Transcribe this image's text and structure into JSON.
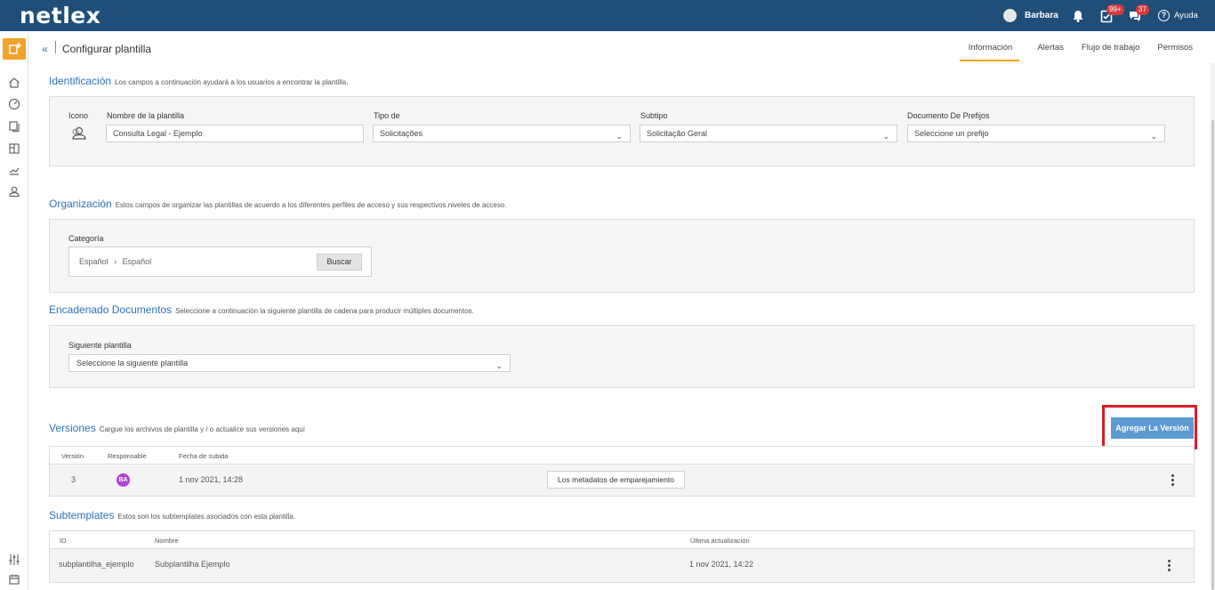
{
  "header": {
    "logo": "netlex",
    "user_name": "Barbara",
    "tasks_badge": "99+",
    "chat_badge": "37",
    "help_label": "Ayuda"
  },
  "page": {
    "title": "Configurar plantilla",
    "collapse": "«",
    "tabs": [
      {
        "label": "Información",
        "active": true
      },
      {
        "label": "Alertas"
      },
      {
        "label": "Flujo de trabajo"
      },
      {
        "label": "Permisos"
      }
    ]
  },
  "identificacion": {
    "title": "Identificación",
    "desc": "Los campos a continuación ayudará a los usuarios a encontrar la plantilla.",
    "icon_label": "Icono",
    "name_label": "Nombre de la plantilla",
    "name_value": "Consulta Legal - Ejemplo",
    "tipo_label": "Tipo de",
    "tipo_value": "Solicitações",
    "subtipo_label": "Subtipo",
    "subtipo_value": "Solicitação Geral",
    "prefix_label": "Documento De Prefijos",
    "prefix_placeholder": "Seleccione un prefijo"
  },
  "organizacion": {
    "title": "Organización",
    "desc": "Estos campos de organizar las plantillas de acuerdo a los diferentes perfiles de acceso y sus respectivos niveles de acceso.",
    "category_label": "Categoría",
    "crumb_1": "Español",
    "crumb_sep": "›",
    "crumb_2": "Español",
    "search_button": "Buscar"
  },
  "encadenado": {
    "title": "Encadenado Documentos",
    "desc": "Seleccione a continuación la siguiente plantilla de cadena para producir múltiples documentos.",
    "next_label": "Siguiente plantilla",
    "next_placeholder": "Seleccione la siguiente plantilla"
  },
  "versiones": {
    "title": "Versiones",
    "desc": "Cargue los archivos de plantilla y / o actualice sus versiones aquí",
    "add_button": "Agregar La Versión",
    "columns": [
      "Versión",
      "Responsable",
      "Fecha de subida"
    ],
    "rows": [
      {
        "version": "3",
        "responsible": "BA",
        "date": "1 nov 2021, 14:28",
        "action": "Los metadatos de emparejamiento"
      }
    ]
  },
  "subtemplates": {
    "title": "Subtemplates",
    "desc": "Estos son los subtemplates asociados con esta plantilla.",
    "columns": [
      "ID",
      "Nombre",
      "Última actualización"
    ],
    "rows": [
      {
        "id": "subplantilha_ejemplo",
        "name": "Subplantilha Ejemplo",
        "updated": "1 nov 2021, 14:22"
      }
    ]
  },
  "colors": {
    "brand": "#1f4e79",
    "accent": "#f2a22a",
    "link": "#2a73b8",
    "button": "#5c9bd1",
    "highlight": "#d71f27"
  }
}
